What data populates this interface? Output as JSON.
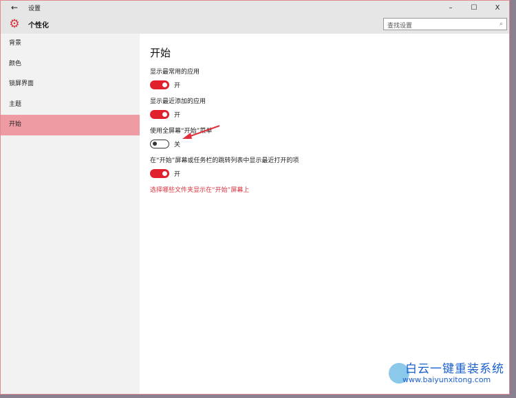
{
  "window": {
    "title": "设置",
    "back_icon": "arrow-left-icon",
    "minimize": "–",
    "maximize": "☐",
    "close": "X"
  },
  "header": {
    "title": "个性化",
    "search_placeholder": "查找设置",
    "accent": "#d9323f"
  },
  "sidebar": {
    "items": [
      {
        "label": "背景"
      },
      {
        "label": "颜色"
      },
      {
        "label": "锁屏界面"
      },
      {
        "label": "主题"
      },
      {
        "label": "开始",
        "selected": true
      }
    ]
  },
  "main": {
    "title": "开始",
    "settings": [
      {
        "label": "显示最常用的应用",
        "on": true,
        "state": "开"
      },
      {
        "label": "显示最近添加的应用",
        "on": true,
        "state": "开"
      },
      {
        "label": "使用全屏幕“开始”菜单",
        "on": false,
        "state": "关"
      },
      {
        "label": "在“开始”屏幕或任务栏的跳转列表中显示最近打开的项",
        "on": true,
        "state": "开"
      }
    ],
    "link": "选择哪些文件夹显示在“开始”屏幕上"
  },
  "watermark": {
    "title": "白云一键重装系统",
    "url": "www.baiyunxitong.com"
  }
}
